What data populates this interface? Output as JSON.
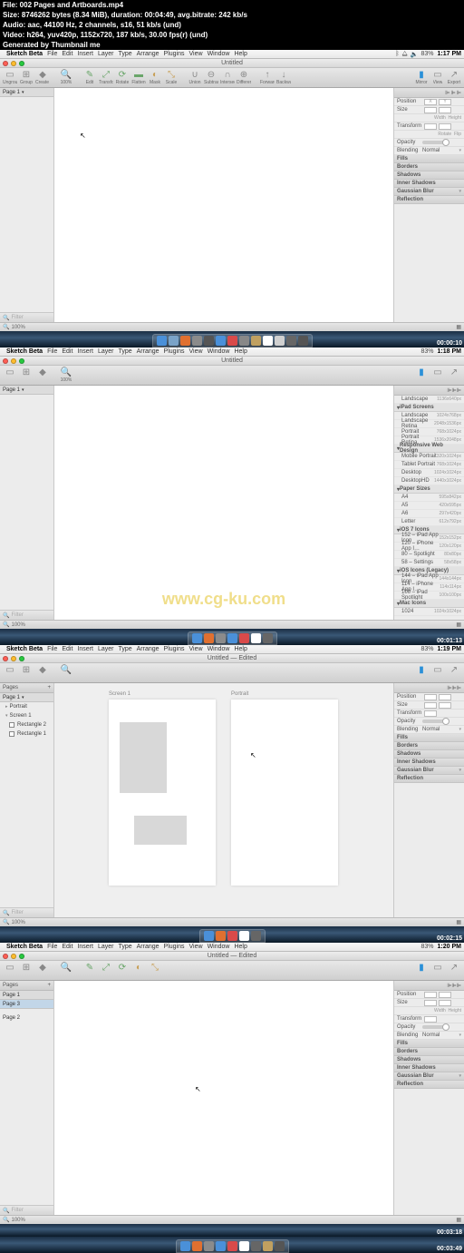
{
  "header": {
    "file": "File: 002 Pages and Artboards.mp4",
    "size": "Size: 8746262 bytes (8.34 MiB), duration: 00:04:49, avg.bitrate: 242 kb/s",
    "audio": "Audio: aac, 44100 Hz, 2 channels, s16, 51 kb/s (und)",
    "video": "Video: h264, yuv420p, 1152x720, 187 kb/s, 30.00 fps(r) (und)",
    "gen": "Generated by Thumbnail me"
  },
  "menubar": {
    "app": "Sketch Beta",
    "items": [
      "File",
      "Edit",
      "Insert",
      "Layer",
      "Type",
      "Arrange",
      "Plugins",
      "View",
      "Window",
      "Help"
    ]
  },
  "time1": "1:17 PM",
  "time2": "1:18 PM",
  "time3": "1:19 PM",
  "time4": "1:20 PM",
  "battery": "83%",
  "window_title_1": "Untitled",
  "window_title_3": "Untitled — Edited",
  "pages_label": "Pages",
  "page1": "Page 1",
  "page2": "Page 2",
  "filter_placeholder": "Filter",
  "bottom_zoom": "100%",
  "toolbar": {
    "items": [
      "Ungroup",
      "Group",
      "Create Symbol",
      "100%",
      "Edit",
      "Transform",
      "Rotate",
      "Flatten",
      "Mask",
      "Scale",
      "Union",
      "Subtract",
      "Intersect",
      "Difference",
      "Forward",
      "Backward",
      "Mirror",
      "View"
    ]
  },
  "inspector": {
    "position": "Position",
    "size": "Size",
    "width": "Width",
    "height": "Height",
    "transform": "Transform",
    "rotate": "Rotate",
    "flip": "Flip",
    "opacity": "Opacity",
    "blending": "Blending",
    "normal": "Normal",
    "fills": "Fills",
    "borders": "Borders",
    "shadows": "Shadows",
    "inner_shadows": "Inner Shadows",
    "gaussian_blur": "Gaussian Blur",
    "reflection": "Reflection",
    "landscape": "Landscape",
    "landscape_dim": "1136x640px"
  },
  "presets": {
    "ipad": "iPad Screens",
    "ipad_items": [
      {
        "n": "Landscape",
        "d": "1024x768px"
      },
      {
        "n": "Landscape Retina",
        "d": "2048x1536px"
      },
      {
        "n": "Portrait",
        "d": "768x1024px"
      },
      {
        "n": "Portrait Retina",
        "d": "1536x2048px"
      }
    ],
    "responsive": "Responsive Web Design",
    "resp_items": [
      {
        "n": "Mobile Portrait",
        "d": "320x1024px"
      },
      {
        "n": "Tablet Portrait",
        "d": "768x1024px"
      },
      {
        "n": "Desktop",
        "d": "1024x1024px"
      },
      {
        "n": "DesktopHD",
        "d": "1440x1024px"
      }
    ],
    "paper": "Paper Sizes",
    "paper_items": [
      {
        "n": "A4",
        "d": "595x842px"
      },
      {
        "n": "A5",
        "d": "420x595px"
      },
      {
        "n": "A6",
        "d": "297x420px"
      },
      {
        "n": "Letter",
        "d": "612x792px"
      }
    ],
    "ios7": "iOS 7 Icons",
    "ios7_items": [
      {
        "n": "152 – iPad App Icon",
        "d": "152x152px"
      },
      {
        "n": "120 – iPhone App I…",
        "d": "120x120px"
      },
      {
        "n": "80 – Spotlight",
        "d": "80x80px"
      },
      {
        "n": "58 – Settings",
        "d": "58x58px"
      }
    ],
    "legacy": "iOS Icons (Legacy)",
    "legacy_items": [
      {
        "n": "144 – iPad App Icon",
        "d": "144x144px"
      },
      {
        "n": "114 – iPhone App I…",
        "d": "114x114px"
      },
      {
        "n": "100 – iPad Spotlight",
        "d": "100x100px"
      }
    ],
    "mac": "Mac Icons",
    "mac_items": [
      {
        "n": "1024",
        "d": "1024x1024px"
      }
    ]
  },
  "layers": {
    "portrait": "Portrait",
    "screen1": "Screen 1",
    "rect2": "Rectangle 2",
    "rect1": "Rectangle 1"
  },
  "artboards": {
    "a1": "Screen 1",
    "a2": "Portrait"
  },
  "timestamps": {
    "t1": "00:00:10",
    "t2": "00:01:13",
    "t3": "00:02:15",
    "t4": "00:03:18",
    "t5": "00:03:49"
  },
  "watermark": "www.cg-ku.com",
  "x": "X",
  "y": "Y"
}
